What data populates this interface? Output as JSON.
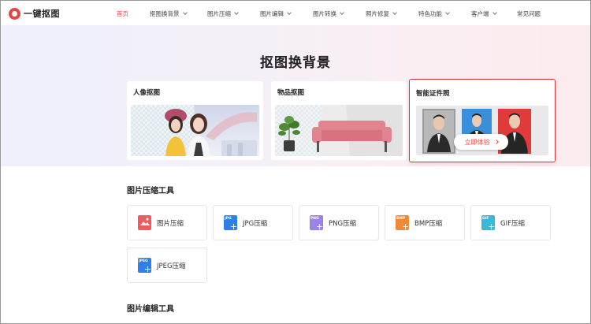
{
  "app": {
    "logo_text": "一键抠图"
  },
  "nav": [
    {
      "label": "首页",
      "active": true,
      "dropdown": false
    },
    {
      "label": "抠图换背景",
      "active": false,
      "dropdown": true
    },
    {
      "label": "图片压缩",
      "active": false,
      "dropdown": true
    },
    {
      "label": "图片编辑",
      "active": false,
      "dropdown": true
    },
    {
      "label": "图片转换",
      "active": false,
      "dropdown": true
    },
    {
      "label": "照片修复",
      "active": false,
      "dropdown": true
    },
    {
      "label": "特色功能",
      "active": false,
      "dropdown": true
    },
    {
      "label": "客户端",
      "active": false,
      "dropdown": true
    },
    {
      "label": "常见问题",
      "active": false,
      "dropdown": false
    }
  ],
  "hero": {
    "title": "抠图换背景",
    "cards": [
      {
        "title": "人像抠图"
      },
      {
        "title": "物品抠图"
      },
      {
        "title": "智能证件照",
        "button": "立即体验"
      }
    ]
  },
  "compress_section": {
    "title": "图片压缩工具",
    "tools": [
      {
        "label": "图片压缩",
        "icon": "image-compress-icon",
        "tag": "",
        "color": "#ea5d5d"
      },
      {
        "label": "JPG压缩",
        "icon": "jpg-icon",
        "tag": "JPG",
        "color": "#2f7fe6"
      },
      {
        "label": "PNG压缩",
        "icon": "png-icon",
        "tag": "PNG",
        "color": "#9b82e6"
      },
      {
        "label": "BMP压缩",
        "icon": "bmp-icon",
        "tag": "BMP",
        "color": "#f0893a"
      },
      {
        "label": "GIF压缩",
        "icon": "gif-icon",
        "tag": "GIF",
        "color": "#3db7d8"
      },
      {
        "label": "JPEG压缩",
        "icon": "jpeg-icon",
        "tag": "JPEG",
        "color": "#2f7fe6"
      }
    ]
  },
  "edit_section": {
    "title": "图片编辑工具"
  }
}
